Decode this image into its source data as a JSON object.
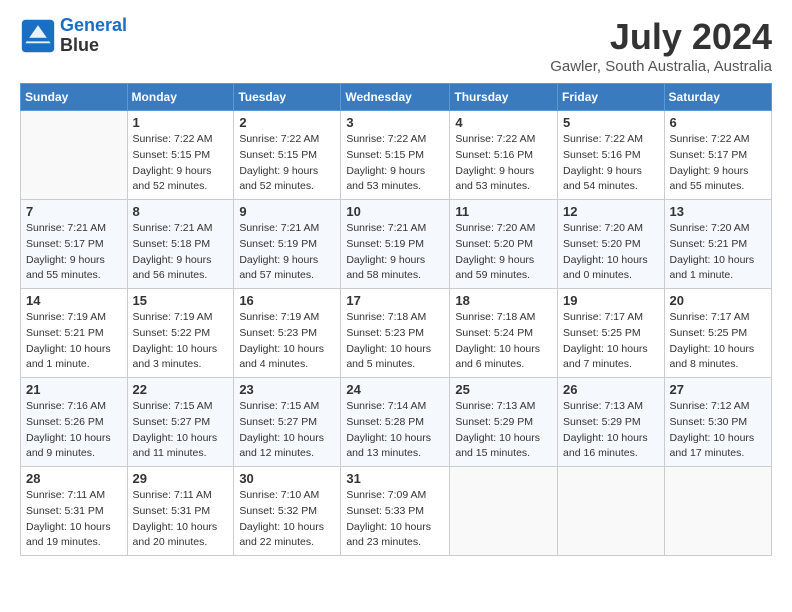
{
  "header": {
    "logo_line1": "General",
    "logo_line2": "Blue",
    "month": "July 2024",
    "location": "Gawler, South Australia, Australia"
  },
  "days_of_week": [
    "Sunday",
    "Monday",
    "Tuesday",
    "Wednesday",
    "Thursday",
    "Friday",
    "Saturday"
  ],
  "weeks": [
    [
      {
        "day": "",
        "info": []
      },
      {
        "day": "1",
        "info": [
          "Sunrise: 7:22 AM",
          "Sunset: 5:15 PM",
          "Daylight: 9 hours",
          "and 52 minutes."
        ]
      },
      {
        "day": "2",
        "info": [
          "Sunrise: 7:22 AM",
          "Sunset: 5:15 PM",
          "Daylight: 9 hours",
          "and 52 minutes."
        ]
      },
      {
        "day": "3",
        "info": [
          "Sunrise: 7:22 AM",
          "Sunset: 5:15 PM",
          "Daylight: 9 hours",
          "and 53 minutes."
        ]
      },
      {
        "day": "4",
        "info": [
          "Sunrise: 7:22 AM",
          "Sunset: 5:16 PM",
          "Daylight: 9 hours",
          "and 53 minutes."
        ]
      },
      {
        "day": "5",
        "info": [
          "Sunrise: 7:22 AM",
          "Sunset: 5:16 PM",
          "Daylight: 9 hours",
          "and 54 minutes."
        ]
      },
      {
        "day": "6",
        "info": [
          "Sunrise: 7:22 AM",
          "Sunset: 5:17 PM",
          "Daylight: 9 hours",
          "and 55 minutes."
        ]
      }
    ],
    [
      {
        "day": "7",
        "info": [
          "Sunrise: 7:21 AM",
          "Sunset: 5:17 PM",
          "Daylight: 9 hours",
          "and 55 minutes."
        ]
      },
      {
        "day": "8",
        "info": [
          "Sunrise: 7:21 AM",
          "Sunset: 5:18 PM",
          "Daylight: 9 hours",
          "and 56 minutes."
        ]
      },
      {
        "day": "9",
        "info": [
          "Sunrise: 7:21 AM",
          "Sunset: 5:19 PM",
          "Daylight: 9 hours",
          "and 57 minutes."
        ]
      },
      {
        "day": "10",
        "info": [
          "Sunrise: 7:21 AM",
          "Sunset: 5:19 PM",
          "Daylight: 9 hours",
          "and 58 minutes."
        ]
      },
      {
        "day": "11",
        "info": [
          "Sunrise: 7:20 AM",
          "Sunset: 5:20 PM",
          "Daylight: 9 hours",
          "and 59 minutes."
        ]
      },
      {
        "day": "12",
        "info": [
          "Sunrise: 7:20 AM",
          "Sunset: 5:20 PM",
          "Daylight: 10 hours",
          "and 0 minutes."
        ]
      },
      {
        "day": "13",
        "info": [
          "Sunrise: 7:20 AM",
          "Sunset: 5:21 PM",
          "Daylight: 10 hours",
          "and 1 minute."
        ]
      }
    ],
    [
      {
        "day": "14",
        "info": [
          "Sunrise: 7:19 AM",
          "Sunset: 5:21 PM",
          "Daylight: 10 hours",
          "and 1 minute."
        ]
      },
      {
        "day": "15",
        "info": [
          "Sunrise: 7:19 AM",
          "Sunset: 5:22 PM",
          "Daylight: 10 hours",
          "and 3 minutes."
        ]
      },
      {
        "day": "16",
        "info": [
          "Sunrise: 7:19 AM",
          "Sunset: 5:23 PM",
          "Daylight: 10 hours",
          "and 4 minutes."
        ]
      },
      {
        "day": "17",
        "info": [
          "Sunrise: 7:18 AM",
          "Sunset: 5:23 PM",
          "Daylight: 10 hours",
          "and 5 minutes."
        ]
      },
      {
        "day": "18",
        "info": [
          "Sunrise: 7:18 AM",
          "Sunset: 5:24 PM",
          "Daylight: 10 hours",
          "and 6 minutes."
        ]
      },
      {
        "day": "19",
        "info": [
          "Sunrise: 7:17 AM",
          "Sunset: 5:25 PM",
          "Daylight: 10 hours",
          "and 7 minutes."
        ]
      },
      {
        "day": "20",
        "info": [
          "Sunrise: 7:17 AM",
          "Sunset: 5:25 PM",
          "Daylight: 10 hours",
          "and 8 minutes."
        ]
      }
    ],
    [
      {
        "day": "21",
        "info": [
          "Sunrise: 7:16 AM",
          "Sunset: 5:26 PM",
          "Daylight: 10 hours",
          "and 9 minutes."
        ]
      },
      {
        "day": "22",
        "info": [
          "Sunrise: 7:15 AM",
          "Sunset: 5:27 PM",
          "Daylight: 10 hours",
          "and 11 minutes."
        ]
      },
      {
        "day": "23",
        "info": [
          "Sunrise: 7:15 AM",
          "Sunset: 5:27 PM",
          "Daylight: 10 hours",
          "and 12 minutes."
        ]
      },
      {
        "day": "24",
        "info": [
          "Sunrise: 7:14 AM",
          "Sunset: 5:28 PM",
          "Daylight: 10 hours",
          "and 13 minutes."
        ]
      },
      {
        "day": "25",
        "info": [
          "Sunrise: 7:13 AM",
          "Sunset: 5:29 PM",
          "Daylight: 10 hours",
          "and 15 minutes."
        ]
      },
      {
        "day": "26",
        "info": [
          "Sunrise: 7:13 AM",
          "Sunset: 5:29 PM",
          "Daylight: 10 hours",
          "and 16 minutes."
        ]
      },
      {
        "day": "27",
        "info": [
          "Sunrise: 7:12 AM",
          "Sunset: 5:30 PM",
          "Daylight: 10 hours",
          "and 17 minutes."
        ]
      }
    ],
    [
      {
        "day": "28",
        "info": [
          "Sunrise: 7:11 AM",
          "Sunset: 5:31 PM",
          "Daylight: 10 hours",
          "and 19 minutes."
        ]
      },
      {
        "day": "29",
        "info": [
          "Sunrise: 7:11 AM",
          "Sunset: 5:31 PM",
          "Daylight: 10 hours",
          "and 20 minutes."
        ]
      },
      {
        "day": "30",
        "info": [
          "Sunrise: 7:10 AM",
          "Sunset: 5:32 PM",
          "Daylight: 10 hours",
          "and 22 minutes."
        ]
      },
      {
        "day": "31",
        "info": [
          "Sunrise: 7:09 AM",
          "Sunset: 5:33 PM",
          "Daylight: 10 hours",
          "and 23 minutes."
        ]
      },
      {
        "day": "",
        "info": []
      },
      {
        "day": "",
        "info": []
      },
      {
        "day": "",
        "info": []
      }
    ]
  ]
}
